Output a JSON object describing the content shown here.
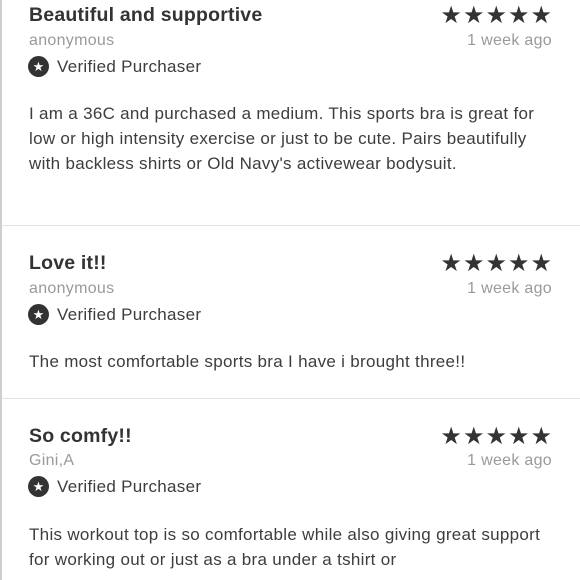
{
  "reviews": [
    {
      "title": "Beautiful and supportive",
      "author": "anonymous",
      "date": "1 week ago",
      "rating": 5,
      "verified_label": "Verified Purchaser",
      "body": "I am a 36C and purchased a medium. This sports bra is great for low or high intensity exercise or just to be cute. Pairs beautifully with backless shirts or Old Navy's activewear bodysuit."
    },
    {
      "title": "Love it!!",
      "author": "anonymous",
      "date": "1 week ago",
      "rating": 5,
      "verified_label": "Verified Purchaser",
      "body": "The most comfortable sports bra I have i brought three!!"
    },
    {
      "title": "So comfy!!",
      "author": "Gini,A",
      "date": "1 week ago",
      "rating": 5,
      "verified_label": "Verified Purchaser",
      "body": "This workout top is so comfortable while also giving great support for working out or just as a bra under a tshirt or"
    }
  ],
  "icons": {
    "star": "star-icon",
    "verified": "verified-star-icon"
  },
  "colors": {
    "text": "#333333",
    "muted": "#9a9a9a",
    "divider": "#e2e2e2"
  }
}
